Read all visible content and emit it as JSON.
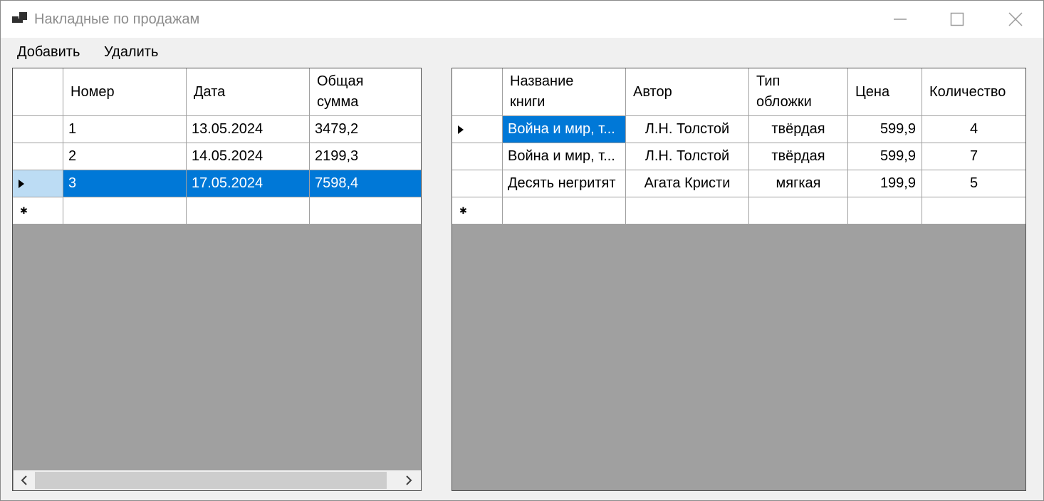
{
  "window": {
    "title": "Накладные по продажам"
  },
  "menu": {
    "add_label": "Добавить",
    "delete_label": "Удалить"
  },
  "invoices_grid": {
    "columns": [
      "Номер",
      "Дата",
      "Общая сумма"
    ],
    "columns_wrapped": [
      "Номер",
      "Дата",
      "Общая\nсумма"
    ],
    "rows": [
      {
        "number": "1",
        "date": "13.05.2024",
        "total": "3479,2"
      },
      {
        "number": "2",
        "date": "14.05.2024",
        "total": "2199,3"
      },
      {
        "number": "3",
        "date": "17.05.2024",
        "total": "7598,4"
      }
    ],
    "selected_row": 3
  },
  "books_grid": {
    "columns": [
      "Название книги",
      "Автор",
      "Тип обложки",
      "Цена",
      "Количество"
    ],
    "rows": [
      {
        "title": "Война и мир, т...",
        "author": "Л.Н. Толстой",
        "cover": "твёрдая",
        "price": "599,9",
        "qty": "4"
      },
      {
        "title": "Война и мир, т...",
        "author": "Л.Н. Толстой",
        "cover": "твёрдая",
        "price": "599,9",
        "qty": "7"
      },
      {
        "title": "Десять негритят",
        "author": "Агата Кристи",
        "cover": "мягкая",
        "price": "199,9",
        "qty": "5"
      }
    ],
    "current_row": 1
  },
  "icons": {
    "app": "app-windows-icon",
    "minimize": "minimize-icon",
    "maximize": "maximize-icon",
    "close": "close-icon",
    "row_current": "row-pointer-icon",
    "new_row": "new-row-asterisk-icon",
    "scroll_left": "scroll-left-icon",
    "scroll_right": "scroll-right-icon"
  },
  "colors": {
    "selection": "#0078d7",
    "selection_rowheader": "#bcdcf4",
    "grid_background": "#a0a0a0",
    "title_text": "#8c8c8c"
  }
}
